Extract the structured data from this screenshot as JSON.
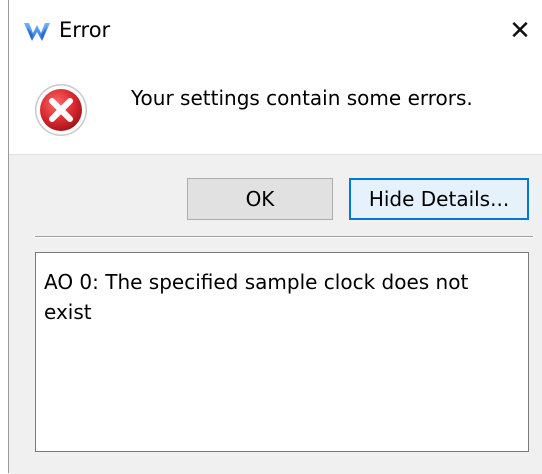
{
  "window": {
    "title": "Error",
    "close_glyph": "✕",
    "app_icon": "app-logo-icon"
  },
  "message": {
    "icon": "error-icon",
    "text": "Your settings contain some errors."
  },
  "buttons": {
    "ok_label": "OK",
    "details_label": "Hide Details..."
  },
  "details": {
    "text": "AO 0: The specified sample clock does not exist"
  },
  "colors": {
    "focus_accent": "#0078d7",
    "error_red": "#d9282f",
    "logo_blue": "#3a8ee6"
  }
}
